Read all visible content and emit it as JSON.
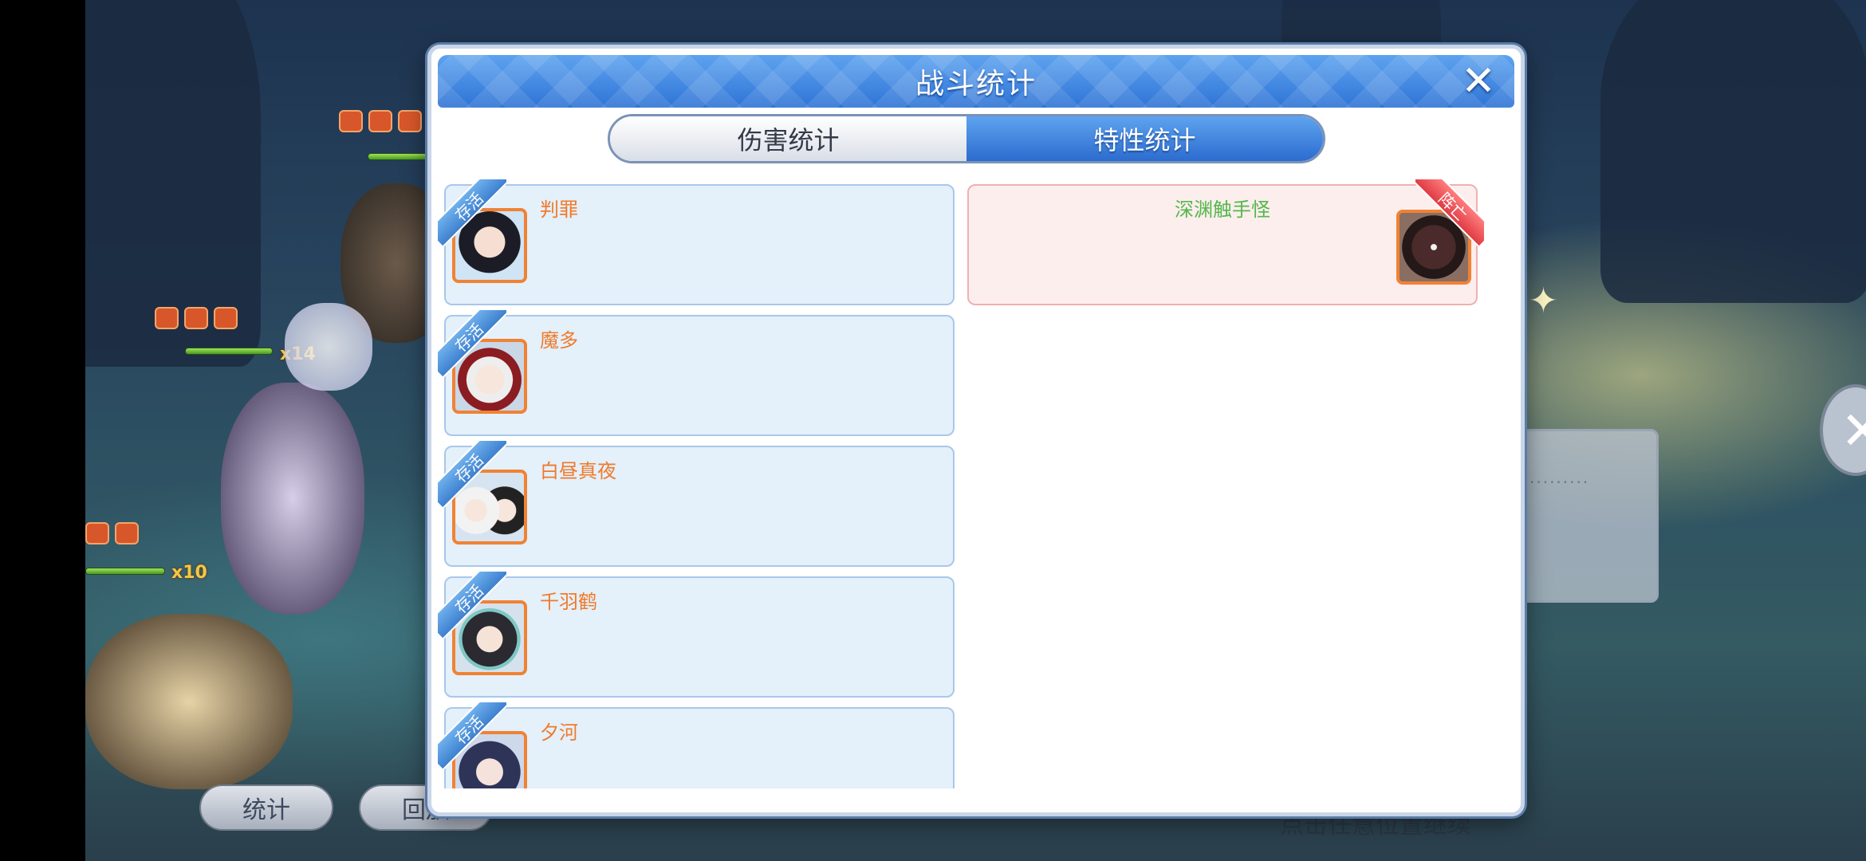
{
  "scene": {
    "stats_button": "统计",
    "replay_button": "回放",
    "continue_hint": "点击任意位置继续",
    "side_dots": "·········",
    "buff_multipliers": [
      "x14",
      "x10"
    ]
  },
  "dialog": {
    "title": "战斗统计",
    "close_icon": "✕",
    "tabs": [
      {
        "label": "伤害统计",
        "active": false
      },
      {
        "label": "特性统计",
        "active": true
      }
    ],
    "allies": [
      {
        "name": "判罪",
        "status": "存活"
      },
      {
        "name": "魔多",
        "status": "存活"
      },
      {
        "name": "白昼真夜",
        "status": "存活"
      },
      {
        "name": "千羽鹤",
        "status": "存活"
      },
      {
        "name": "夕河",
        "status": "存活"
      }
    ],
    "enemies": [
      {
        "name": "深渊触手怪",
        "status": "阵亡"
      }
    ]
  },
  "colors": {
    "header_blue": "#2f74d6",
    "ally_name": "#f07a2a",
    "enemy_name": "#53b84a",
    "alive_ribbon": "#3d80cf",
    "dead_ribbon": "#e03b44"
  }
}
